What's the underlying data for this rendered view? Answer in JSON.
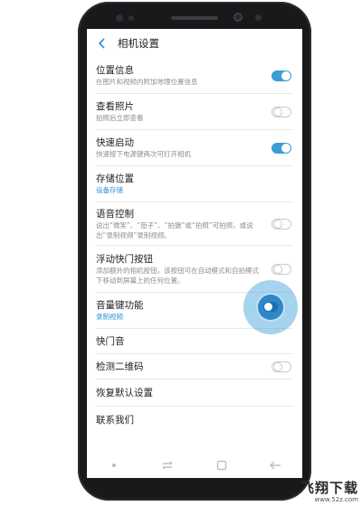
{
  "header": {
    "title": "相机设置"
  },
  "settings": [
    {
      "title": "位置信息",
      "subtitle": "在图片和视频内附加地理位置信息",
      "toggle": "on"
    },
    {
      "title": "查看照片",
      "subtitle": "拍照后立即查看",
      "toggle": "off"
    },
    {
      "title": "快速启动",
      "subtitle": "快速按下电源键两次可打开相机",
      "toggle": "on"
    },
    {
      "title": "存储位置",
      "subtitle": "设备存储",
      "toggle": null
    },
    {
      "title": "语音控制",
      "subtitle": "说出“微笑”、“茄子”、“拍摄”或“拍照”可拍照，或说出“录制视频”录制视频。",
      "toggle": "off"
    },
    {
      "title": "浮动快门按钮",
      "subtitle": "添加额外的相机按钮，该按钮可在自动模式和自拍模式下移动到屏幕上的任何位置。",
      "toggle": "off"
    },
    {
      "title": "音量键功能",
      "subtitle": "录制视频",
      "toggle": null
    },
    {
      "title": "快门音",
      "subtitle": "",
      "toggle": "on"
    },
    {
      "title": "检测二维码",
      "subtitle": "",
      "toggle": "off"
    },
    {
      "title": "恢复默认设置",
      "subtitle": "",
      "toggle": null
    },
    {
      "title": "联系我们",
      "subtitle": "",
      "toggle": null
    }
  ],
  "icons": {
    "back": "chevron-left-icon",
    "nav_dot": "nav-dot-icon",
    "nav_recents": "recents-icon",
    "nav_home": "home-icon",
    "nav_back": "back-arrow-icon"
  },
  "colors": {
    "accent": "#3a9ed7",
    "toggle_off": "#c9c9c9"
  },
  "watermark": {
    "main": "飞翔下载",
    "url": "www.52z.com"
  }
}
